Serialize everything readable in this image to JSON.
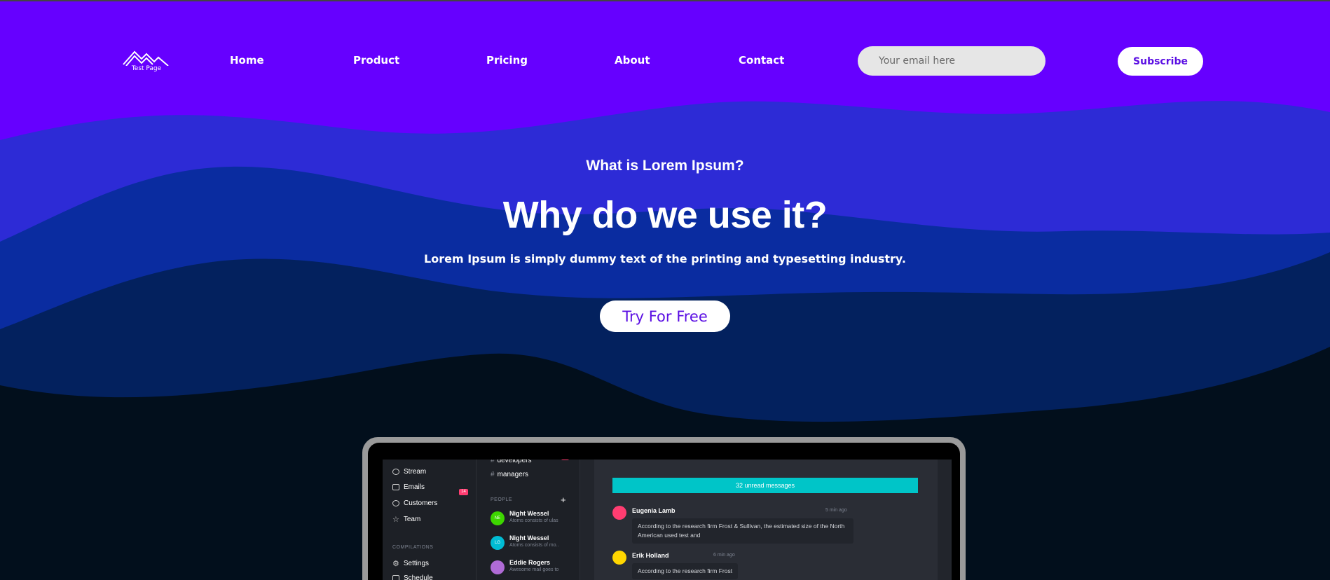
{
  "header": {
    "logo_text": "Test Page",
    "nav": [
      {
        "label": "Home"
      },
      {
        "label": "Product"
      },
      {
        "label": "Pricing"
      },
      {
        "label": "About"
      },
      {
        "label": "Contact"
      }
    ],
    "email_placeholder": "Your email here",
    "subscribe_label": "Subscribe"
  },
  "hero": {
    "eyebrow": "What is Lorem Ipsum?",
    "title": "Why do we use it?",
    "subtitle": "Lorem Ipsum is simply dummy text of the printing and typesetting industry.",
    "cta_label": "Try For Free"
  },
  "colors": {
    "wave_1": "#6600ff",
    "wave_2": "#2d2bd6",
    "wave_3": "#0a2ca0",
    "wave_4": "#03215e",
    "wave_5": "#020f1c",
    "accent": "#5b0fe3",
    "teal": "#00c5c8"
  },
  "mockup": {
    "sidebar": {
      "items": [
        {
          "label": "Stream",
          "icon": "stream-icon"
        },
        {
          "label": "Emails",
          "icon": "mail-icon",
          "badge": "14"
        },
        {
          "label": "Customers",
          "icon": "users-icon"
        },
        {
          "label": "Team",
          "icon": "star-icon"
        }
      ],
      "section_label": "COMPILATIONS",
      "bottom_items": [
        {
          "label": "Settings",
          "icon": "gear-icon"
        },
        {
          "label": "Schedule",
          "icon": "calendar-icon"
        }
      ]
    },
    "channels": {
      "items": [
        {
          "label": "developers",
          "badge": "24"
        },
        {
          "label": "managers"
        }
      ],
      "people_label": "PEOPLE",
      "people": [
        {
          "name": "Night Wessel",
          "message": "Atoms consists of ulas",
          "initials": "NE",
          "color": "#3dd600"
        },
        {
          "name": "Night Wessel",
          "message": "Atoms consists of mo..",
          "initials": "LG",
          "color": "#00bcd4"
        },
        {
          "name": "Eddie Rogers",
          "message": "Awesome mail goes to",
          "initials": "",
          "color": "#b06bd6"
        }
      ]
    },
    "chat": {
      "unread_label": "32 unread messages",
      "messages": [
        {
          "name": "Eugenia Lamb",
          "time": "5 min ago",
          "text": "According to the research firm Frost & Sullivan, the estimated size of the North American used test and",
          "avatar_color": "#ff3d71"
        },
        {
          "name": "Erik Holland",
          "time": "6 min ago",
          "text": "According to the research firm Frost",
          "avatar_color": "#ffd600"
        }
      ]
    }
  }
}
